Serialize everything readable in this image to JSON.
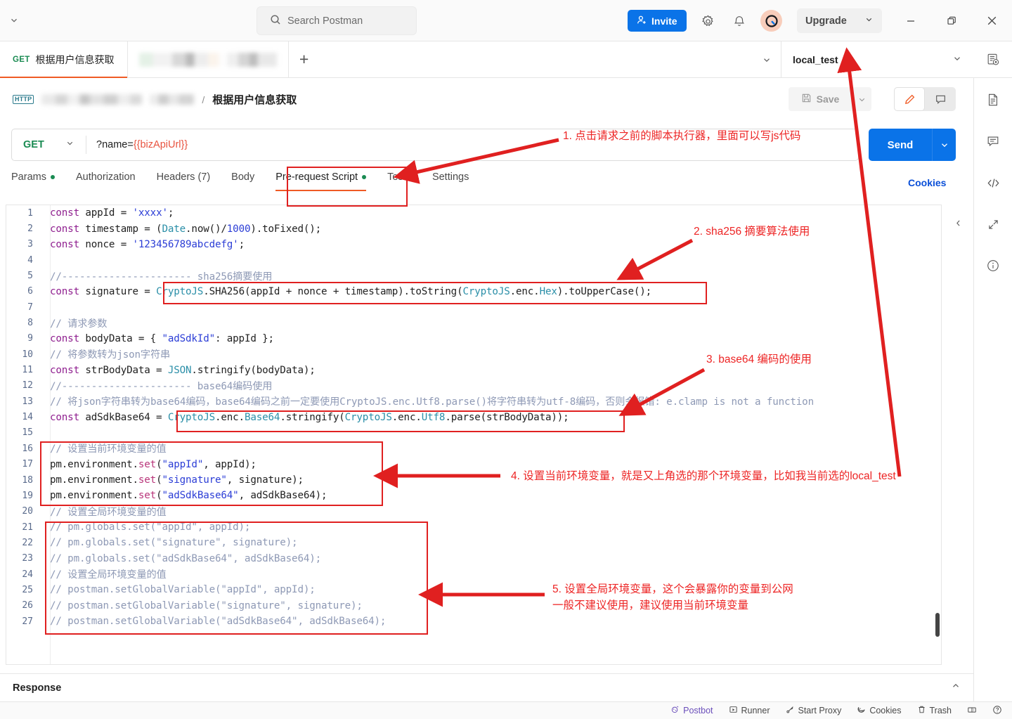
{
  "titlebar": {
    "search_placeholder": "Search Postman",
    "invite_label": "Invite",
    "upgrade_label": "Upgrade",
    "icons": [
      "search-icon",
      "gear-icon",
      "bell-icon",
      "avatar",
      "minimize-icon",
      "maximize-icon",
      "close-icon"
    ]
  },
  "tabstrip": {
    "tab_method": "GET",
    "tab_label": "根据用户信息获取",
    "new_tab_label": "+",
    "environment": "local_test"
  },
  "breadcrumb": {
    "separator": "/",
    "title": "根据用户信息获取",
    "protocol_badge": "HTTP",
    "save_label": "Save"
  },
  "urlbar": {
    "method": "GET",
    "url_prefix": "?name=",
    "url_variable": "{{bizApiUrl}}",
    "send_label": "Send"
  },
  "request_tabs": {
    "items": [
      {
        "label": "Params",
        "dot": true,
        "active": false
      },
      {
        "label": "Authorization",
        "dot": false,
        "active": false
      },
      {
        "label": "Headers (7)",
        "dot": false,
        "active": false
      },
      {
        "label": "Body",
        "dot": false,
        "active": false
      },
      {
        "label": "Pre-request Script",
        "dot": true,
        "active": true
      },
      {
        "label": "Tests",
        "dot": false,
        "active": false
      },
      {
        "label": "Settings",
        "dot": false,
        "active": false
      }
    ],
    "cookies_label": "Cookies"
  },
  "editor": {
    "lines": [
      {
        "n": "1",
        "html": "<span class='k'>const</span> appId = <span class='s'>'xxxx'</span>;"
      },
      {
        "n": "2",
        "html": "<span class='k'>const</span> timestamp = (<span class='ty'>Date</span>.now()/<span class='s'>1000</span>).toFixed();"
      },
      {
        "n": "3",
        "html": "<span class='k'>const</span> nonce = <span class='s'>'123456789abcdefg'</span>;"
      },
      {
        "n": "4",
        "html": ""
      },
      {
        "n": "5",
        "html": "<span class='c'>//---------------------- sha256摘要使用</span>"
      },
      {
        "n": "6",
        "html": "<span class='k'>const</span> signature = <span class='ty'>CryptoJS</span>.<span class='fn'>SHA256</span>(appId + nonce + timestamp).toString(<span class='ty'>CryptoJS</span>.enc.<span class='ty'>Hex</span>).toUpperCase();"
      },
      {
        "n": "7",
        "html": ""
      },
      {
        "n": "8",
        "html": "<span class='c'>// 请求参数</span>"
      },
      {
        "n": "9",
        "html": "<span class='k'>const</span> bodyData = { <span class='s'>\"adSdkId\"</span>: appId };"
      },
      {
        "n": "10",
        "html": "<span class='c'>// 将参数转为json字符串</span>"
      },
      {
        "n": "11",
        "html": "<span class='k'>const</span> strBodyData = <span class='ty'>JSON</span>.stringify(bodyData);"
      },
      {
        "n": "12",
        "html": "<span class='c'>//---------------------- base64编码使用</span>"
      },
      {
        "n": "13",
        "html": "<span class='c'>// 将json字符串转为base64编码，base64编码之前一定要使用CryptoJS.enc.Utf8.parse()将字符串转为utf-8编码，否则会报错: e.clamp is not a function</span>"
      },
      {
        "n": "14",
        "html": "<span class='k'>const</span> adSdkBase64 = <span class='ty'>CryptoJS</span>.enc.<span class='ty'>Base64</span>.stringify(<span class='ty'>CryptoJS</span>.enc.<span class='ty'>Utf8</span>.parse(strBodyData));"
      },
      {
        "n": "15",
        "html": ""
      },
      {
        "n": "16",
        "html": "<span class='c'>// 设置当前环境变量的值</span>"
      },
      {
        "n": "17",
        "html": "pm.environment.<span class='mm'>set</span>(<span class='s'>\"appId\"</span>, appId);"
      },
      {
        "n": "18",
        "html": "pm.environment.<span class='mm'>set</span>(<span class='s'>\"signature\"</span>, signature);"
      },
      {
        "n": "19",
        "html": "pm.environment.<span class='mm'>set</span>(<span class='s'>\"adSdkBase64\"</span>, adSdkBase64);"
      },
      {
        "n": "20",
        "html": "<span class='c'>// 设置全局环境变量的值</span>"
      },
      {
        "n": "21",
        "html": "<span class='c'>// pm.globals.set(\"appId\", appId);</span>"
      },
      {
        "n": "22",
        "html": "<span class='c'>// pm.globals.set(\"signature\", signature);</span>"
      },
      {
        "n": "23",
        "html": "<span class='c'>// pm.globals.set(\"adSdkBase64\", adSdkBase64);</span>"
      },
      {
        "n": "24",
        "html": "<span class='c'>// 设置全局环境变量的值</span>"
      },
      {
        "n": "25",
        "html": "<span class='c'>// postman.setGlobalVariable(\"appId\", appId);</span>"
      },
      {
        "n": "26",
        "html": "<span class='c'>// postman.setGlobalVariable(\"signature\", signature);</span>"
      },
      {
        "n": "27",
        "html": "<span class='c'>// postman.setGlobalVariable(\"adSdkBase64\", adSdkBase64);</span>"
      }
    ]
  },
  "response": {
    "title": "Response"
  },
  "statusbar": {
    "items": [
      {
        "label": "Postbot",
        "icon": "postbot-icon"
      },
      {
        "label": "Runner",
        "icon": "runner-icon"
      },
      {
        "label": "Start Proxy",
        "icon": "proxy-icon"
      },
      {
        "label": "Cookies",
        "icon": "cookies-icon"
      },
      {
        "label": "Trash",
        "icon": "trash-icon"
      },
      {
        "label": "",
        "icon": "layout-icon"
      },
      {
        "label": "",
        "icon": "help-icon"
      }
    ]
  },
  "annotations": {
    "color": "#ed2424",
    "items": [
      {
        "id": "1",
        "text": "1. 点击请求之前的脚本执行器，里面可以写js代码"
      },
      {
        "id": "2",
        "text": "2. sha256 摘要算法使用"
      },
      {
        "id": "3",
        "text": "3. base64 编码的使用"
      },
      {
        "id": "4",
        "text": "4. 设置当前环境变量，就是又上角选的那个环境变量，比如我当前选的local_test"
      },
      {
        "id": "5",
        "text": "5. 设置全局环境变量，这个会暴露你的变量到公网"
      },
      {
        "id": "5b",
        "text": "一般不建议使用，建议使用当前环境变量"
      }
    ]
  },
  "colors": {
    "accent_orange": "#ef5b25",
    "brand_blue": "#0a73e8",
    "annotation_red": "#ed2424",
    "method_green": "#1a8b52"
  }
}
